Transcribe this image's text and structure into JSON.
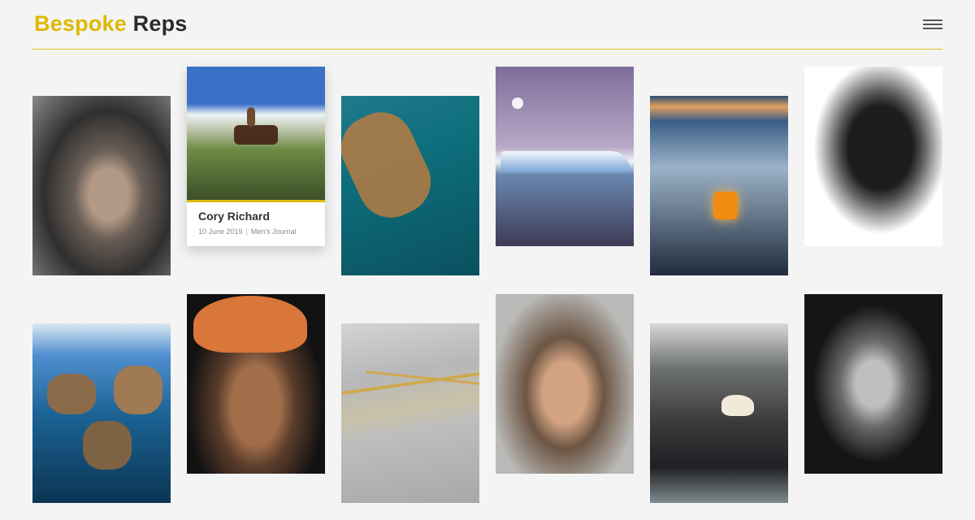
{
  "header": {
    "brand_first": "Bespoke",
    "brand_second": "Reps",
    "menu_icon": "hamburger-icon",
    "accent_color": "#e0b800"
  },
  "gallery": {
    "featured_card": {
      "title": "Cory Richard",
      "date": "10 June 2019",
      "publication": "Men's Journal"
    }
  }
}
